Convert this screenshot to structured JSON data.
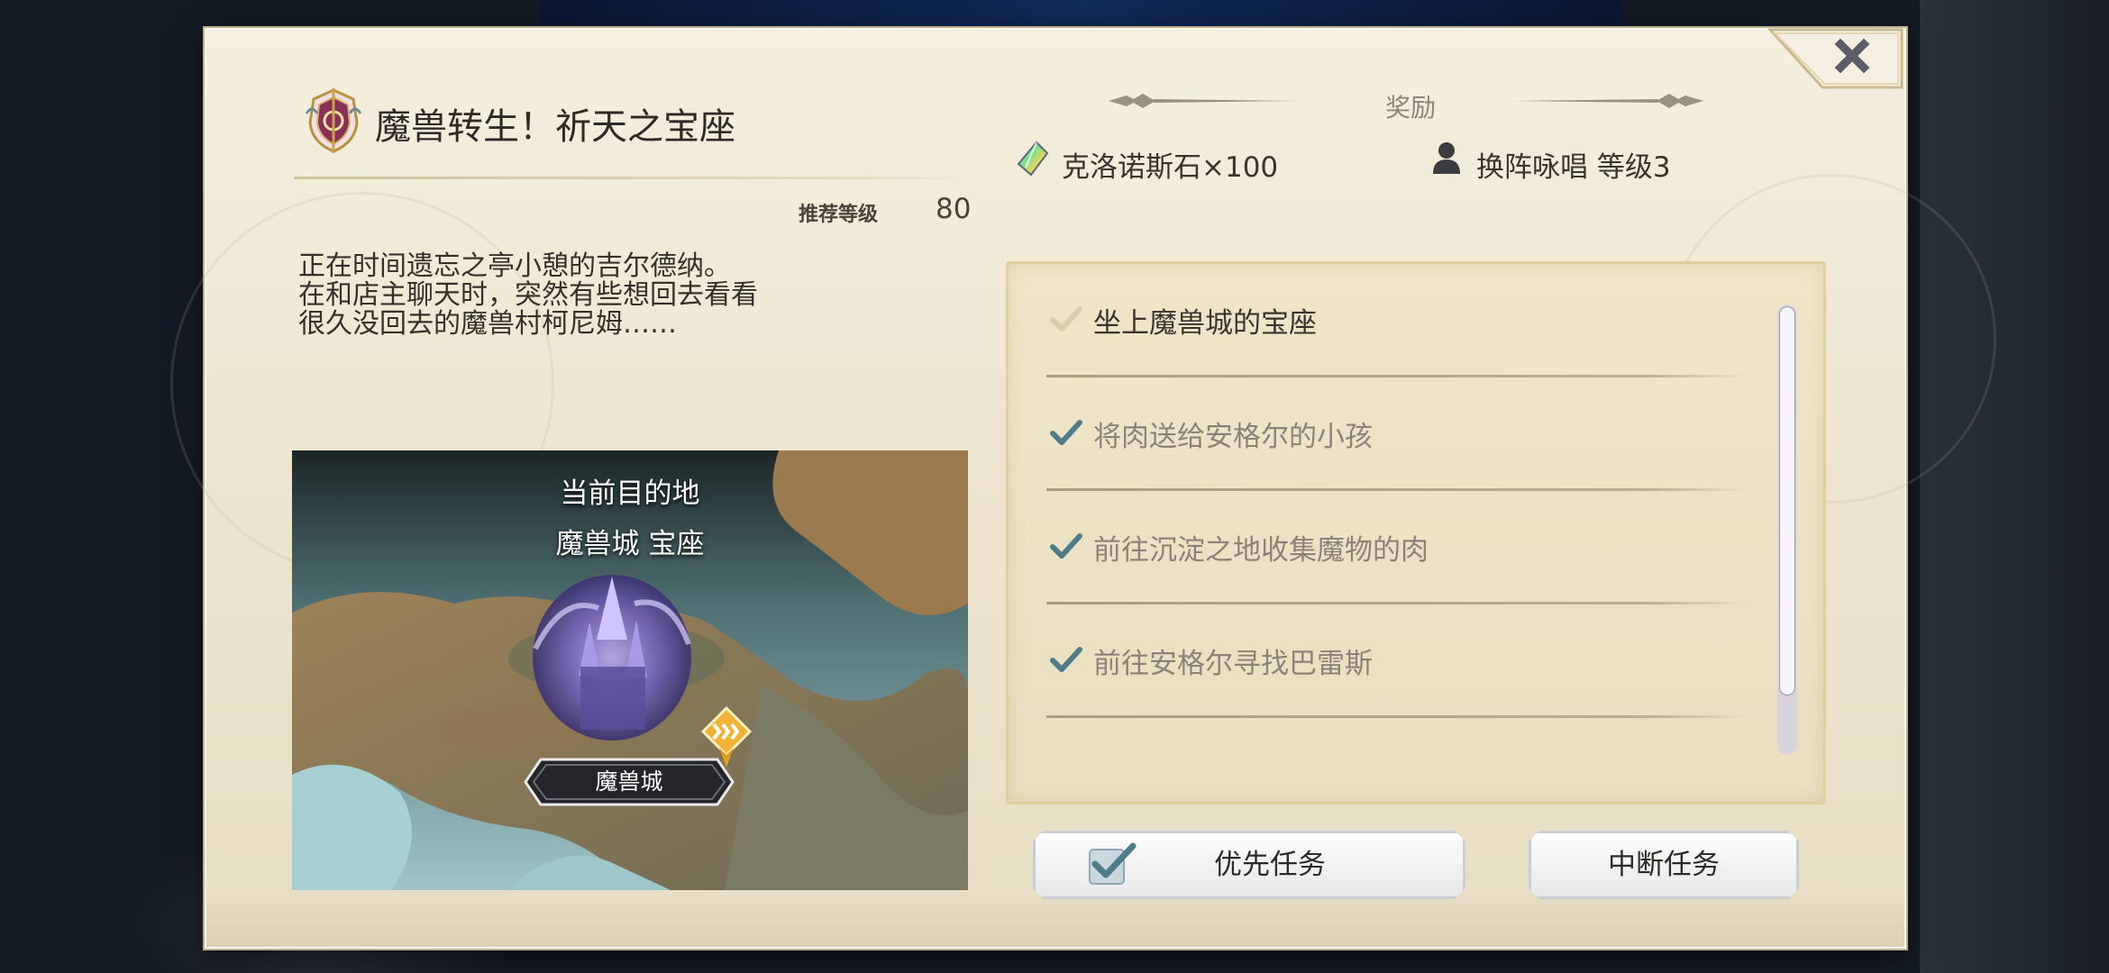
{
  "quest": {
    "title": "魔兽转生！祈天之宝座",
    "recommended_level_label": "推荐等级",
    "recommended_level": "80",
    "description": [
      "正在时间遗忘之亭小憩的吉尔德纳。",
      "在和店主聊天时，突然有些想回去看看",
      "很久没回去的魔兽村柯尼姆……"
    ]
  },
  "map": {
    "destination_label": "当前目的地",
    "destination_name": "魔兽城 宝座",
    "location_tag": "魔兽城"
  },
  "rewards": {
    "title": "奖励",
    "items": [
      {
        "icon": "crystal-icon",
        "text": "克洛诺斯石×100"
      },
      {
        "icon": "person-icon",
        "text": "换阵咏唱 等级3"
      }
    ]
  },
  "objectives": [
    {
      "text": "坐上魔兽城的宝座",
      "status": "current"
    },
    {
      "text": "将肉送给安格尔的小孩",
      "status": "done"
    },
    {
      "text": "前往沉淀之地收集魔物的肉",
      "status": "done"
    },
    {
      "text": "前往安格尔寻找巴雷斯",
      "status": "done"
    }
  ],
  "buttons": {
    "priority": "优先任务",
    "abort": "中断任务",
    "close": "close"
  },
  "colors": {
    "check_done": "#4f7c88",
    "check_current": "#d8ccae",
    "panel_border": "#dfcf9c",
    "dialog_bg": "#f1ebda"
  }
}
